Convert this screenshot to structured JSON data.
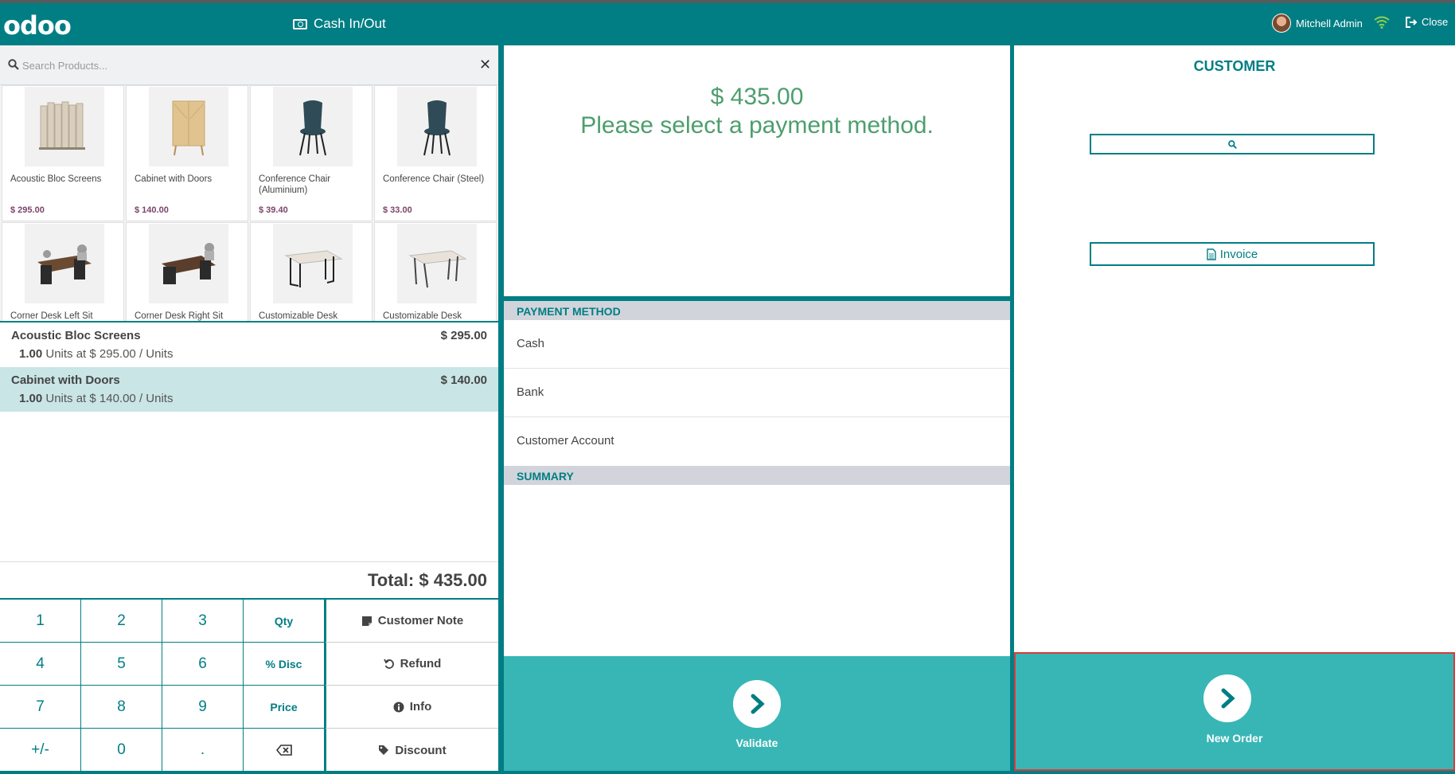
{
  "header": {
    "logo": "odoo",
    "cash_in_out": "Cash In/Out",
    "user_name": "Mitchell Admin",
    "close_label": "Close"
  },
  "search": {
    "placeholder": "Search Products..."
  },
  "products": [
    {
      "name": "Acoustic Bloc Screens",
      "price": "$ 295.00"
    },
    {
      "name": "Cabinet with Doors",
      "price": "$ 140.00"
    },
    {
      "name": "Conference Chair (Aluminium)",
      "price": "$ 39.40"
    },
    {
      "name": "Conference Chair (Steel)",
      "price": "$ 33.00"
    },
    {
      "name": "Corner Desk Left Sit",
      "price": ""
    },
    {
      "name": "Corner Desk Right Sit",
      "price": ""
    },
    {
      "name": "Customizable Desk",
      "price": ""
    },
    {
      "name": "Customizable Desk",
      "price": ""
    }
  ],
  "order_lines": [
    {
      "name": "Acoustic Bloc Screens",
      "price": "$ 295.00",
      "qty": "1.00",
      "info": " Units at $ 295.00 / Units"
    },
    {
      "name": "Cabinet with Doors",
      "price": "$ 140.00",
      "qty": "1.00",
      "info": " Units at $ 140.00 / Units"
    }
  ],
  "total": "Total: $ 435.00",
  "numpad": {
    "keys": [
      "1",
      "2",
      "3",
      "Qty",
      "4",
      "5",
      "6",
      "% Disc",
      "7",
      "8",
      "9",
      "Price",
      "+/-",
      "0",
      "."
    ],
    "customer_note": "Customer Note",
    "refund": "Refund",
    "info": "Info",
    "discount": "Discount"
  },
  "payment": {
    "amount": "$ 435.00",
    "message": "Please select a payment method.",
    "method_header": "PAYMENT METHOD",
    "methods": [
      "Cash",
      "Bank",
      "Customer Account"
    ],
    "summary_header": "SUMMARY",
    "validate": "Validate"
  },
  "customer": {
    "title": "CUSTOMER",
    "invoice": "Invoice",
    "new_order": "New Order"
  },
  "colors": {
    "brand": "#017e84",
    "action": "#38b6b6",
    "price_text": "#7c4469",
    "status_text": "#4d9e6e"
  }
}
